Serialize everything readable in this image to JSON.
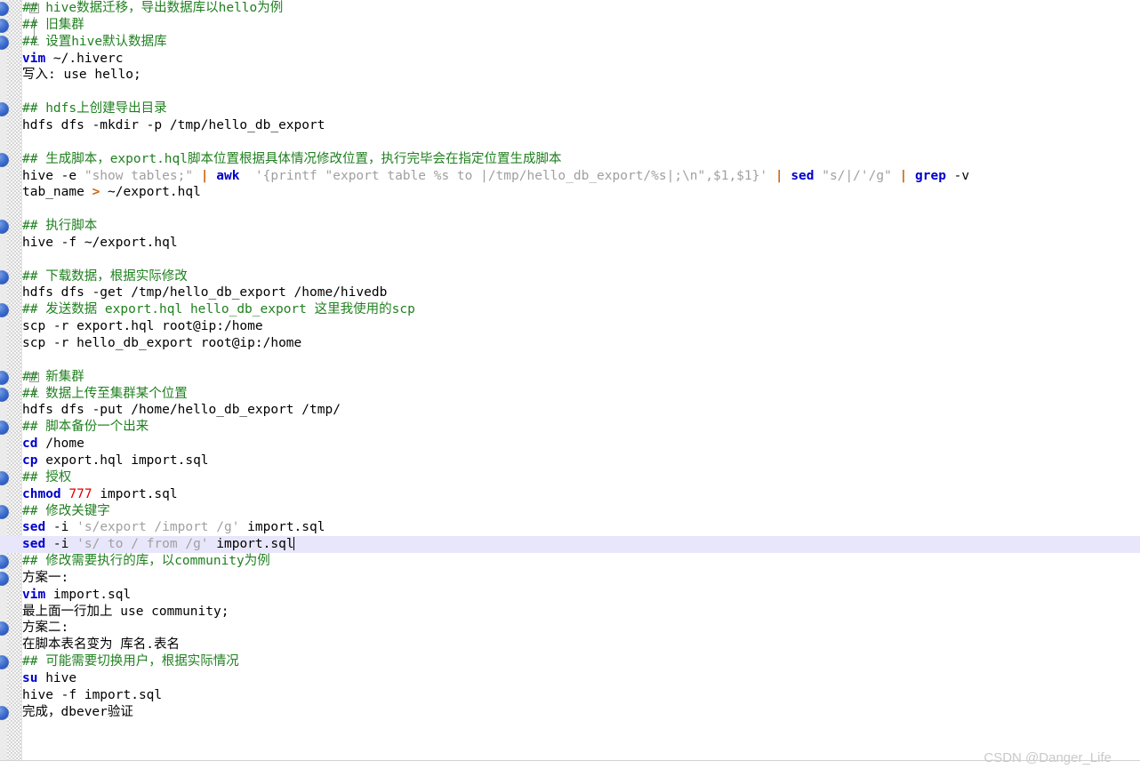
{
  "editor": {
    "watermark": "CSDN @Danger_Life",
    "colors": {
      "comment": "#208020",
      "keyword": "#0000cc",
      "string": "#a0a0a0",
      "number": "#dd0000",
      "operator": "#cc6611",
      "plain": "#000000",
      "current_line_highlight": "#e7e6fb",
      "gutter": "#ebebeb",
      "background": "#ffffff"
    },
    "current_line_index": 32,
    "lines": [
      {
        "i": 0,
        "bookmark": true,
        "fold": "start",
        "segs": [
          {
            "t": "## hive数据迁移，导出数据库以hello为例",
            "c": "cm"
          }
        ]
      },
      {
        "i": 1,
        "bookmark": true,
        "fold": "mid",
        "segs": [
          {
            "t": "## 旧集群",
            "c": "cm"
          }
        ]
      },
      {
        "i": 2,
        "bookmark": true,
        "fold": "end",
        "segs": [
          {
            "t": "## 设置hive默认数据库",
            "c": "cm"
          }
        ]
      },
      {
        "i": 3,
        "bookmark": false,
        "fold": null,
        "segs": [
          {
            "t": "vim",
            "c": "kw"
          },
          {
            "t": " ~/.hiverc",
            "c": "plain"
          }
        ]
      },
      {
        "i": 4,
        "bookmark": false,
        "fold": null,
        "segs": [
          {
            "t": "写入: use hello;",
            "c": "plain"
          }
        ]
      },
      {
        "i": 5,
        "bookmark": false,
        "fold": null,
        "segs": []
      },
      {
        "i": 6,
        "bookmark": true,
        "fold": null,
        "segs": [
          {
            "t": "## hdfs上创建导出目录",
            "c": "cm"
          }
        ]
      },
      {
        "i": 7,
        "bookmark": false,
        "fold": null,
        "segs": [
          {
            "t": "hdfs dfs -mkdir -p /tmp/hello_db_export",
            "c": "plain"
          }
        ]
      },
      {
        "i": 8,
        "bookmark": false,
        "fold": null,
        "segs": []
      },
      {
        "i": 9,
        "bookmark": true,
        "fold": null,
        "segs": [
          {
            "t": "## 生成脚本，export.hql脚本位置根据具体情况修改位置，执行完毕会在指定位置生成脚本",
            "c": "cm"
          }
        ]
      },
      {
        "i": 10,
        "bookmark": false,
        "fold": null,
        "segs": [
          {
            "t": "hive -e ",
            "c": "plain"
          },
          {
            "t": "\"show tables;\"",
            "c": "str"
          },
          {
            "t": " ",
            "c": "plain"
          },
          {
            "t": "|",
            "c": "op"
          },
          {
            "t": " ",
            "c": "plain"
          },
          {
            "t": "awk",
            "c": "kw"
          },
          {
            "t": "  ",
            "c": "plain"
          },
          {
            "t": "'{printf \"export table %s to |/tmp/hello_db_export/%s|;\\n\",$1,$1}'",
            "c": "str"
          },
          {
            "t": " ",
            "c": "plain"
          },
          {
            "t": "|",
            "c": "op"
          },
          {
            "t": " ",
            "c": "plain"
          },
          {
            "t": "sed",
            "c": "kw"
          },
          {
            "t": " ",
            "c": "plain"
          },
          {
            "t": "\"s/|/'/g\"",
            "c": "str"
          },
          {
            "t": " ",
            "c": "plain"
          },
          {
            "t": "|",
            "c": "op"
          },
          {
            "t": " ",
            "c": "plain"
          },
          {
            "t": "grep",
            "c": "kw"
          },
          {
            "t": " -v",
            "c": "plain"
          }
        ]
      },
      {
        "i": 11,
        "bookmark": false,
        "fold": null,
        "segs": [
          {
            "t": "tab_name ",
            "c": "plain"
          },
          {
            "t": ">",
            "c": "op"
          },
          {
            "t": " ~/export.hql",
            "c": "plain"
          }
        ]
      },
      {
        "i": 12,
        "bookmark": false,
        "fold": null,
        "segs": []
      },
      {
        "i": 13,
        "bookmark": true,
        "fold": null,
        "segs": [
          {
            "t": "## 执行脚本",
            "c": "cm"
          }
        ]
      },
      {
        "i": 14,
        "bookmark": false,
        "fold": null,
        "segs": [
          {
            "t": "hive -f ~/export.hql",
            "c": "plain"
          }
        ]
      },
      {
        "i": 15,
        "bookmark": false,
        "fold": null,
        "segs": []
      },
      {
        "i": 16,
        "bookmark": true,
        "fold": null,
        "segs": [
          {
            "t": "## 下载数据，根据实际修改",
            "c": "cm"
          }
        ]
      },
      {
        "i": 17,
        "bookmark": false,
        "fold": null,
        "segs": [
          {
            "t": "hdfs dfs -get /tmp/hello_db_export /home/hivedb",
            "c": "plain"
          }
        ]
      },
      {
        "i": 18,
        "bookmark": true,
        "fold": null,
        "segs": [
          {
            "t": "## 发送数据 export.hql hello_db_export 这里我使用的scp",
            "c": "cm"
          }
        ]
      },
      {
        "i": 19,
        "bookmark": false,
        "fold": null,
        "segs": [
          {
            "t": "scp -r export.hql root@ip:/home",
            "c": "plain"
          }
        ]
      },
      {
        "i": 20,
        "bookmark": false,
        "fold": null,
        "segs": [
          {
            "t": "scp -r hello_db_export root@ip:/home",
            "c": "plain"
          }
        ]
      },
      {
        "i": 21,
        "bookmark": false,
        "fold": null,
        "segs": []
      },
      {
        "i": 22,
        "bookmark": true,
        "fold": "start",
        "segs": [
          {
            "t": "## 新集群",
            "c": "cm"
          }
        ]
      },
      {
        "i": 23,
        "bookmark": true,
        "fold": "end",
        "segs": [
          {
            "t": "## 数据上传至集群某个位置",
            "c": "cm"
          }
        ]
      },
      {
        "i": 24,
        "bookmark": false,
        "fold": null,
        "segs": [
          {
            "t": "hdfs dfs -put /home/hello_db_export /tmp/",
            "c": "plain"
          }
        ]
      },
      {
        "i": 25,
        "bookmark": true,
        "fold": null,
        "segs": [
          {
            "t": "## 脚本备份一个出来",
            "c": "cm"
          }
        ]
      },
      {
        "i": 26,
        "bookmark": false,
        "fold": null,
        "segs": [
          {
            "t": "cd",
            "c": "kw"
          },
          {
            "t": " /home",
            "c": "plain"
          }
        ]
      },
      {
        "i": 27,
        "bookmark": false,
        "fold": null,
        "segs": [
          {
            "t": "cp",
            "c": "kw"
          },
          {
            "t": " export.hql import.sql",
            "c": "plain"
          }
        ]
      },
      {
        "i": 28,
        "bookmark": true,
        "fold": null,
        "segs": [
          {
            "t": "## 授权",
            "c": "cm"
          }
        ]
      },
      {
        "i": 29,
        "bookmark": false,
        "fold": null,
        "segs": [
          {
            "t": "chmod",
            "c": "kw"
          },
          {
            "t": " ",
            "c": "plain"
          },
          {
            "t": "777",
            "c": "num"
          },
          {
            "t": " import.sql",
            "c": "plain"
          }
        ]
      },
      {
        "i": 30,
        "bookmark": true,
        "fold": null,
        "segs": [
          {
            "t": "## 修改关键字",
            "c": "cm"
          }
        ]
      },
      {
        "i": 31,
        "bookmark": false,
        "fold": null,
        "segs": [
          {
            "t": "sed",
            "c": "kw"
          },
          {
            "t": " -i ",
            "c": "plain"
          },
          {
            "t": "'s/export /import /g'",
            "c": "str"
          },
          {
            "t": " import.sql",
            "c": "plain"
          }
        ]
      },
      {
        "i": 32,
        "bookmark": false,
        "fold": null,
        "segs": [
          {
            "t": "sed",
            "c": "kw"
          },
          {
            "t": " -i ",
            "c": "plain"
          },
          {
            "t": "'s/ to / from /g'",
            "c": "str"
          },
          {
            "t": " import.sql",
            "c": "plain"
          }
        ],
        "cursor": true
      },
      {
        "i": 33,
        "bookmark": true,
        "fold": null,
        "segs": [
          {
            "t": "## 修改需要执行的库，以community为例",
            "c": "cm"
          }
        ]
      },
      {
        "i": 34,
        "bookmark": true,
        "fold": null,
        "segs": [
          {
            "t": "方案一:",
            "c": "plain"
          }
        ]
      },
      {
        "i": 35,
        "bookmark": false,
        "fold": null,
        "segs": [
          {
            "t": "vim",
            "c": "kw"
          },
          {
            "t": " import.sql",
            "c": "plain"
          }
        ]
      },
      {
        "i": 36,
        "bookmark": false,
        "fold": null,
        "segs": [
          {
            "t": "最上面一行加上 use community;",
            "c": "plain"
          }
        ]
      },
      {
        "i": 37,
        "bookmark": true,
        "fold": null,
        "segs": [
          {
            "t": "方案二:",
            "c": "plain"
          }
        ]
      },
      {
        "i": 38,
        "bookmark": false,
        "fold": null,
        "segs": [
          {
            "t": "在脚本表名变为 库名.表名",
            "c": "plain"
          }
        ]
      },
      {
        "i": 39,
        "bookmark": true,
        "fold": null,
        "segs": [
          {
            "t": "## 可能需要切换用户，根据实际情况",
            "c": "cm"
          }
        ]
      },
      {
        "i": 40,
        "bookmark": false,
        "fold": null,
        "segs": [
          {
            "t": "su",
            "c": "kw"
          },
          {
            "t": " hive",
            "c": "plain"
          }
        ]
      },
      {
        "i": 41,
        "bookmark": false,
        "fold": null,
        "segs": [
          {
            "t": "hive -f import.sql",
            "c": "plain"
          }
        ]
      },
      {
        "i": 42,
        "bookmark": true,
        "fold": null,
        "segs": [
          {
            "t": "完成，dbever验证",
            "c": "plain"
          }
        ]
      }
    ]
  }
}
